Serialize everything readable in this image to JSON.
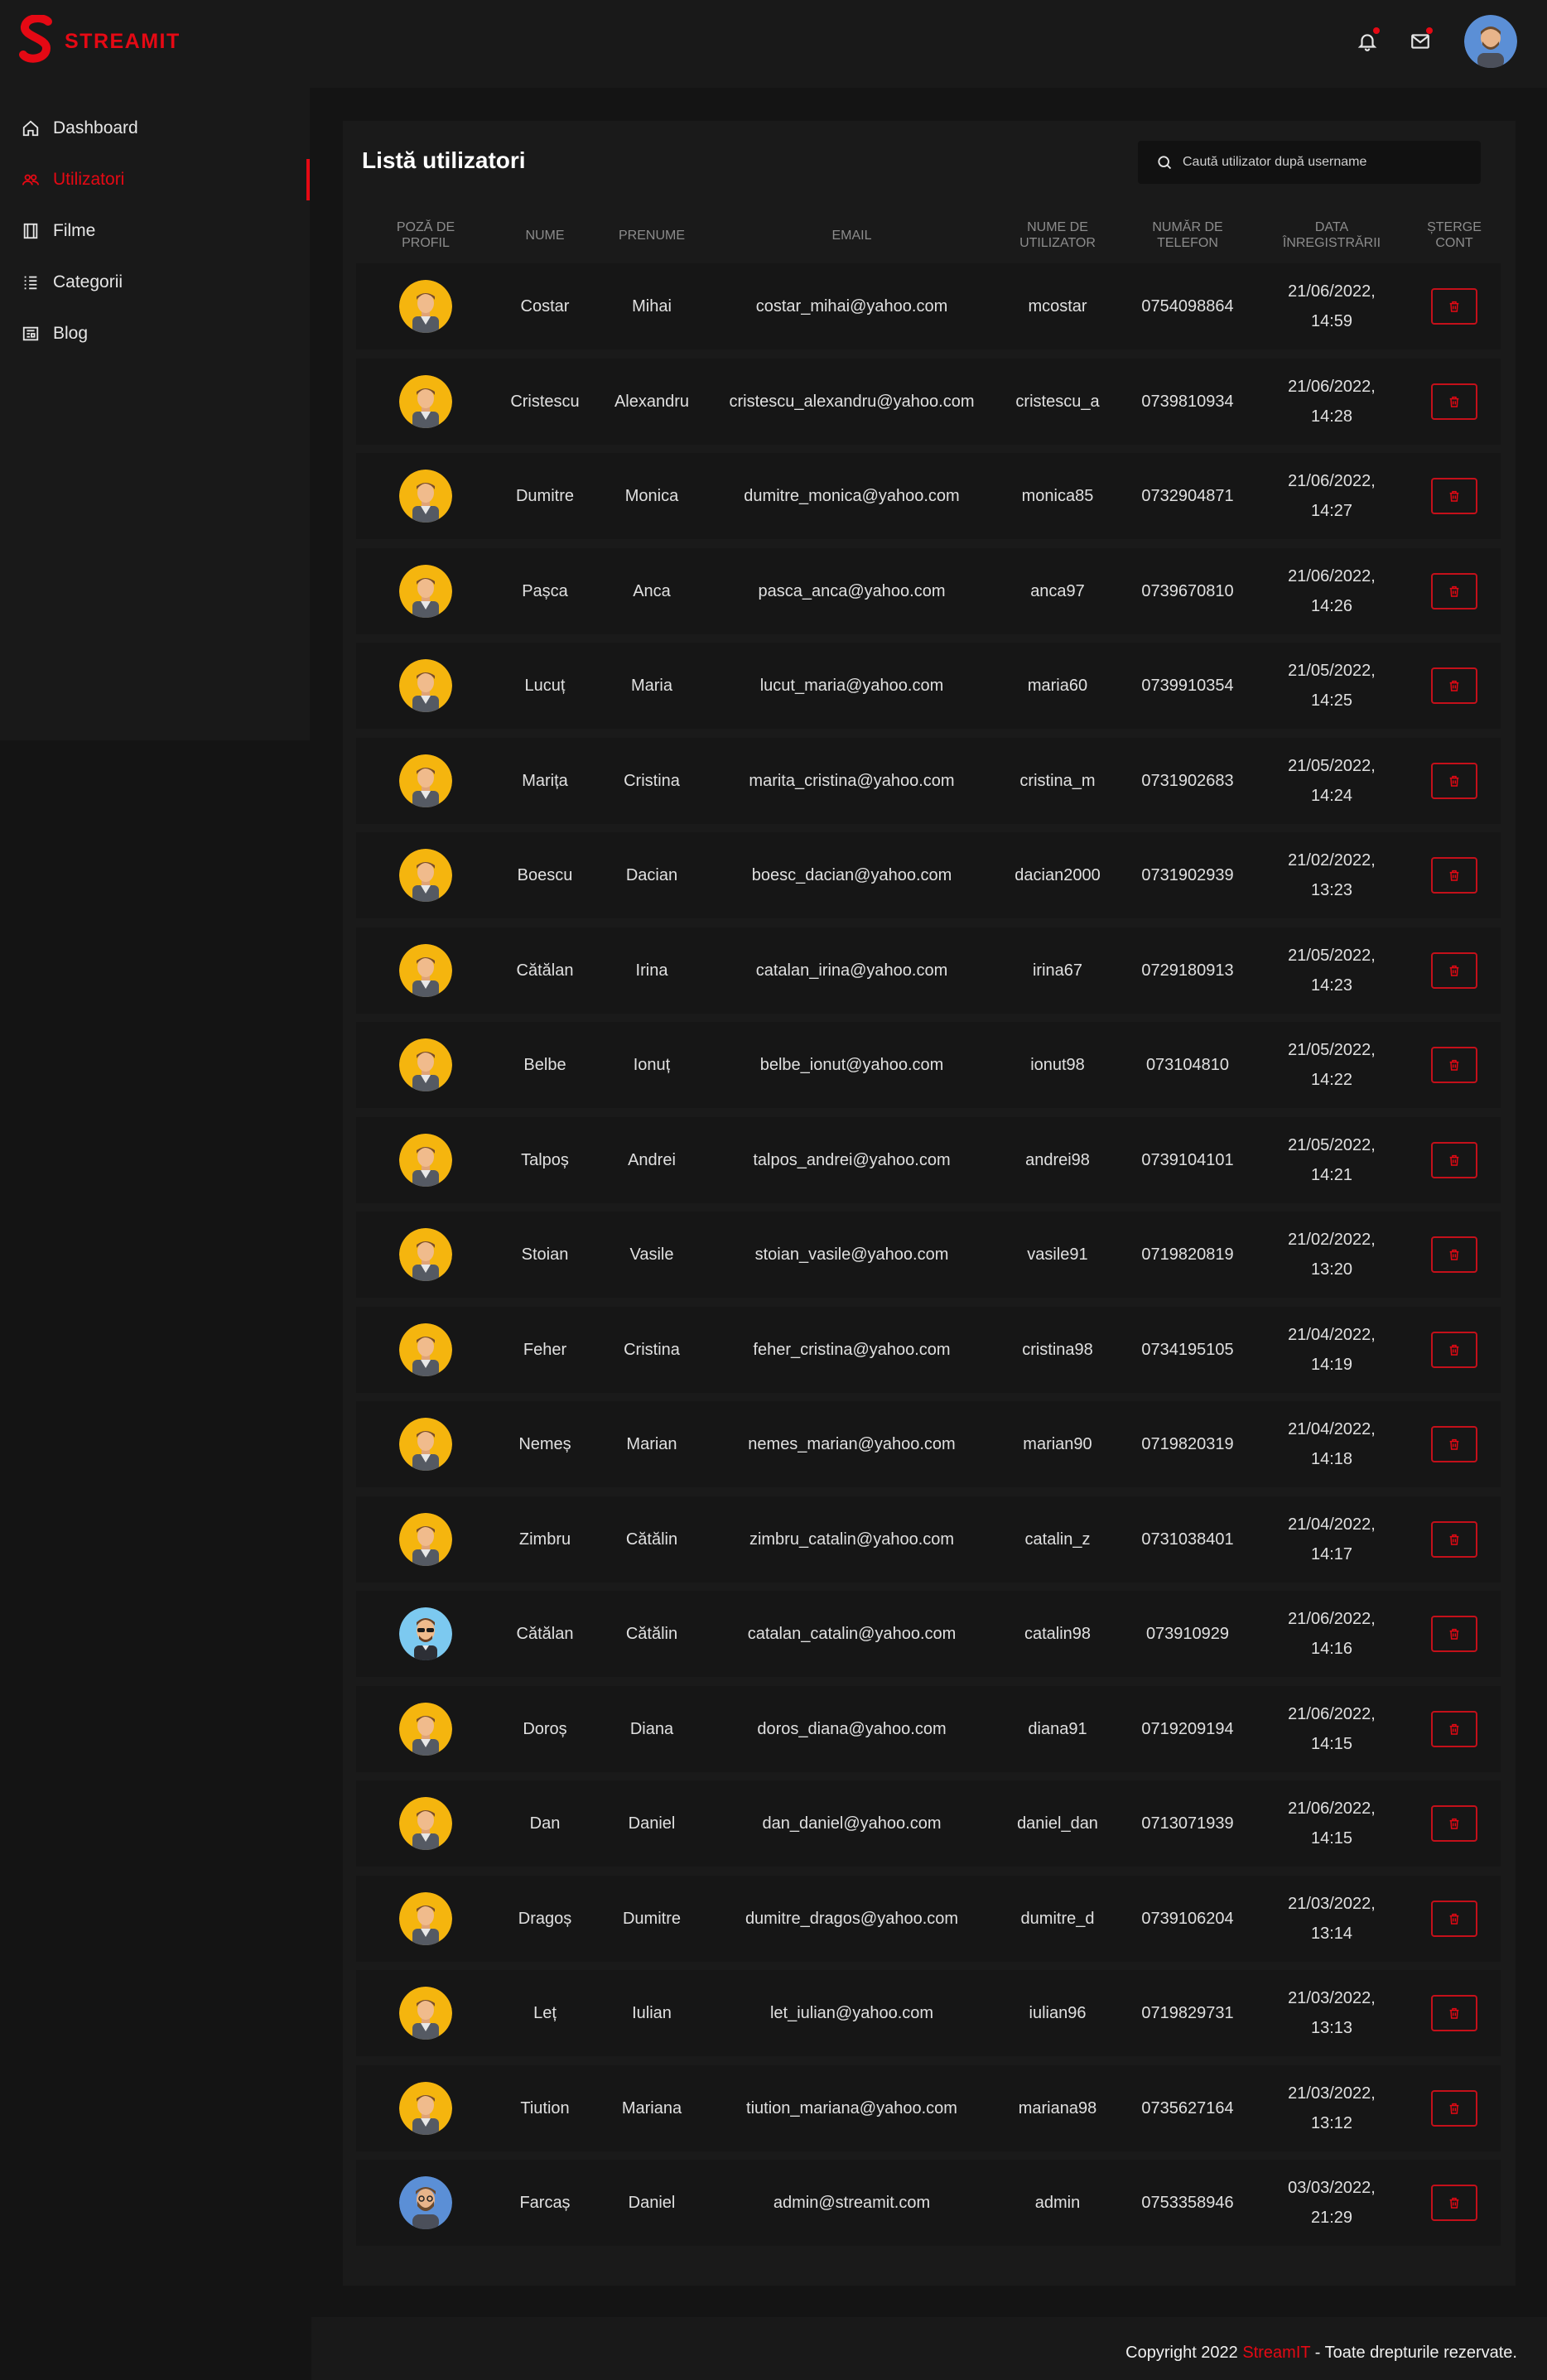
{
  "brand": {
    "name": "STREAMIT",
    "accent": "#e50914"
  },
  "header": {
    "icons": [
      "bell-icon",
      "mail-icon"
    ],
    "avatar": "user-avatar"
  },
  "sidebar": {
    "items": [
      {
        "label": "Dashboard",
        "icon": "home-icon"
      },
      {
        "label": "Utilizatori",
        "icon": "users-icon",
        "active": true
      },
      {
        "label": "Filme",
        "icon": "film-icon"
      },
      {
        "label": "Categorii",
        "icon": "list-icon"
      },
      {
        "label": "Blog",
        "icon": "newspaper-icon"
      }
    ]
  },
  "main": {
    "title": "Listă utilizatori",
    "search_placeholder": "Caută utilizator după username",
    "columns": [
      "POZĂ DE PROFIL",
      "NUME",
      "PRENUME",
      "EMAIL",
      "NUME DE UTILIZATOR",
      "NUMĂR DE TELEFON",
      "DATA ÎNREGISTRĂRII",
      "ȘTERGE CONT"
    ],
    "rows": [
      {
        "nume": "Costar",
        "prenume": "Mihai",
        "email": "costar_mihai@yahoo.com",
        "username": "mcostar",
        "telefon": "0754098864",
        "data1": "21/06/2022,",
        "data2": "14:59",
        "avatar": "default"
      },
      {
        "nume": "Cristescu",
        "prenume": "Alexandru",
        "email": "cristescu_alexandru@yahoo.com",
        "username": "cristescu_a",
        "telefon": "0739810934",
        "data1": "21/06/2022,",
        "data2": "14:28",
        "avatar": "default"
      },
      {
        "nume": "Dumitre",
        "prenume": "Monica",
        "email": "dumitre_monica@yahoo.com",
        "username": "monica85",
        "telefon": "0732904871",
        "data1": "21/06/2022,",
        "data2": "14:27",
        "avatar": "default"
      },
      {
        "nume": "Pașca",
        "prenume": "Anca",
        "email": "pasca_anca@yahoo.com",
        "username": "anca97",
        "telefon": "0739670810",
        "data1": "21/06/2022,",
        "data2": "14:26",
        "avatar": "default"
      },
      {
        "nume": "Lucuț",
        "prenume": "Maria",
        "email": "lucut_maria@yahoo.com",
        "username": "maria60",
        "telefon": "0739910354",
        "data1": "21/05/2022,",
        "data2": "14:25",
        "avatar": "default"
      },
      {
        "nume": "Marița",
        "prenume": "Cristina",
        "email": "marita_cristina@yahoo.com",
        "username": "cristina_m",
        "telefon": "0731902683",
        "data1": "21/05/2022,",
        "data2": "14:24",
        "avatar": "default"
      },
      {
        "nume": "Boescu",
        "prenume": "Dacian",
        "email": "boesc_dacian@yahoo.com",
        "username": "dacian2000",
        "telefon": "0731902939",
        "data1": "21/02/2022,",
        "data2": "13:23",
        "avatar": "default"
      },
      {
        "nume": "Cătălan",
        "prenume": "Irina",
        "email": "catalan_irina@yahoo.com",
        "username": "irina67",
        "telefon": "0729180913",
        "data1": "21/05/2022,",
        "data2": "14:23",
        "avatar": "default"
      },
      {
        "nume": "Belbe",
        "prenume": "Ionuț",
        "email": "belbe_ionut@yahoo.com",
        "username": "ionut98",
        "telefon": "073104810",
        "data1": "21/05/2022,",
        "data2": "14:22",
        "avatar": "default"
      },
      {
        "nume": "Talpoș",
        "prenume": "Andrei",
        "email": "talpos_andrei@yahoo.com",
        "username": "andrei98",
        "telefon": "0739104101",
        "data1": "21/05/2022,",
        "data2": "14:21",
        "avatar": "default"
      },
      {
        "nume": "Stoian",
        "prenume": "Vasile",
        "email": "stoian_vasile@yahoo.com",
        "username": "vasile91",
        "telefon": "0719820819",
        "data1": "21/02/2022,",
        "data2": "13:20",
        "avatar": "default"
      },
      {
        "nume": "Feher",
        "prenume": "Cristina",
        "email": "feher_cristina@yahoo.com",
        "username": "cristina98",
        "telefon": "0734195105",
        "data1": "21/04/2022,",
        "data2": "14:19",
        "avatar": "default"
      },
      {
        "nume": "Nemeș",
        "prenume": "Marian",
        "email": "nemes_marian@yahoo.com",
        "username": "marian90",
        "telefon": "0719820319",
        "data1": "21/04/2022,",
        "data2": "14:18",
        "avatar": "default"
      },
      {
        "nume": "Zimbru",
        "prenume": "Cătălin",
        "email": "zimbru_catalin@yahoo.com",
        "username": "catalin_z",
        "telefon": "0731038401",
        "data1": "21/04/2022,",
        "data2": "14:17",
        "avatar": "default"
      },
      {
        "nume": "Cătălan",
        "prenume": "Cătălin",
        "email": "catalan_catalin@yahoo.com",
        "username": "catalin98",
        "telefon": "073910929",
        "data1": "21/06/2022,",
        "data2": "14:16",
        "avatar": "sunglasses"
      },
      {
        "nume": "Doroș",
        "prenume": "Diana",
        "email": "doros_diana@yahoo.com",
        "username": "diana91",
        "telefon": "0719209194",
        "data1": "21/06/2022,",
        "data2": "14:15",
        "avatar": "default"
      },
      {
        "nume": "Dan",
        "prenume": "Daniel",
        "email": "dan_daniel@yahoo.com",
        "username": "daniel_dan",
        "telefon": "0713071939",
        "data1": "21/06/2022,",
        "data2": "14:15",
        "avatar": "default"
      },
      {
        "nume": "Dragoș",
        "prenume": "Dumitre",
        "email": "dumitre_dragos@yahoo.com",
        "username": "dumitre_d",
        "telefon": "0739106204",
        "data1": "21/03/2022,",
        "data2": "13:14",
        "avatar": "default"
      },
      {
        "nume": "Leț",
        "prenume": "Iulian",
        "email": "let_iulian@yahoo.com",
        "username": "iulian96",
        "telefon": "0719829731",
        "data1": "21/03/2022,",
        "data2": "13:13",
        "avatar": "default"
      },
      {
        "nume": "Tiution",
        "prenume": "Mariana",
        "email": "tiution_mariana@yahoo.com",
        "username": "mariana98",
        "telefon": "0735627164",
        "data1": "21/03/2022,",
        "data2": "13:12",
        "avatar": "default"
      },
      {
        "nume": "Farcaș",
        "prenume": "Daniel",
        "email": "admin@streamit.com",
        "username": "admin",
        "telefon": "0753358946",
        "data1": "03/03/2022,",
        "data2": "21:29",
        "avatar": "bearded"
      }
    ]
  },
  "footer": {
    "prefix": "Copyright 2022 ",
    "brand": "StreamIT",
    "suffix": " - Toate drepturile rezervate."
  }
}
